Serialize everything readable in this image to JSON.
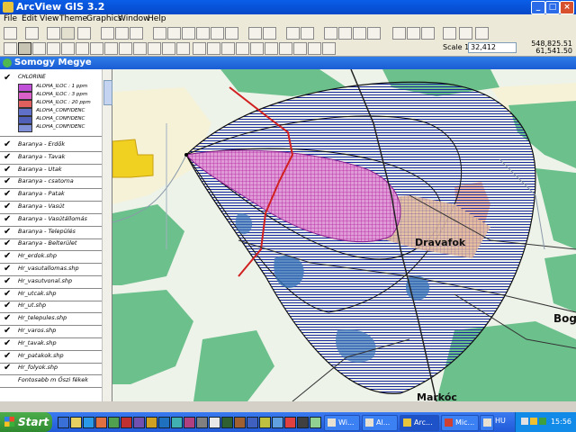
{
  "window": {
    "title": "ArcView GIS 3.2"
  },
  "menu": [
    "File",
    "Edit",
    "View",
    "Theme",
    "Graphics",
    "Window",
    "Help"
  ],
  "toolbar": {
    "scale_label": "Scale 1:",
    "scale_value": "32,412",
    "coord_x": "548,825.51",
    "coord_y": "61,541.50"
  },
  "view": {
    "title": "Somogy Megye"
  },
  "toc": {
    "legend_group": "CHLORINE",
    "legend": [
      {
        "label": "ALOHA_ILOC : 1 ppm",
        "color": "#c050d8"
      },
      {
        "label": "ALOHA_ILOC : 3 ppm",
        "color": "#d860c8"
      },
      {
        "label": "ALOHA_ILOC : 20 ppm",
        "color": "#e06060"
      },
      {
        "label": "ALOHA_CONFIDENC",
        "color": "#6070c8"
      },
      {
        "label": "ALOHA_CONFIDENC",
        "color": "#5060b8"
      },
      {
        "label": "ALOHA_CONFIDENC",
        "color": "#8090d8"
      }
    ],
    "themes": [
      "Baranya - Erdők",
      "Baranya - Tavak",
      "Baranya - Utak",
      "Baranya - csatorna",
      "Baranya - Patak",
      "Baranya - Vasút",
      "Baranya - Vasútállomás",
      "Baranya - Település",
      "Baranya - Belterület",
      "Hr_erdok.shp",
      "Hr_vasutallomas.shp",
      "Hr_vasutvonal.shp",
      "Hr_utcak.shp",
      "Hr_ut.shp",
      "Hr_telepules.shp",
      "Hr_varos.shp",
      "Hr_tavak.shp",
      "Hr_patakok.shp",
      "Hr_folyok.shp",
      "Fontosabb m Őszi fékek"
    ]
  },
  "map": {
    "labels": {
      "town1": "Dravafok",
      "town2": "Markóc",
      "town3": "Bog"
    }
  },
  "taskbar": {
    "start": "Start",
    "tasks": [
      "Wi...",
      "Al...",
      "Arc...",
      "Mic...",
      ""
    ],
    "lang": "HU",
    "clock": "15:56"
  },
  "colors": {
    "plume_purple": "#c030c0",
    "confidence_blue": "#1a2a9a",
    "forest": "#6cc08c",
    "water": "#3a74b8",
    "settlement": "#f0b8a0"
  }
}
